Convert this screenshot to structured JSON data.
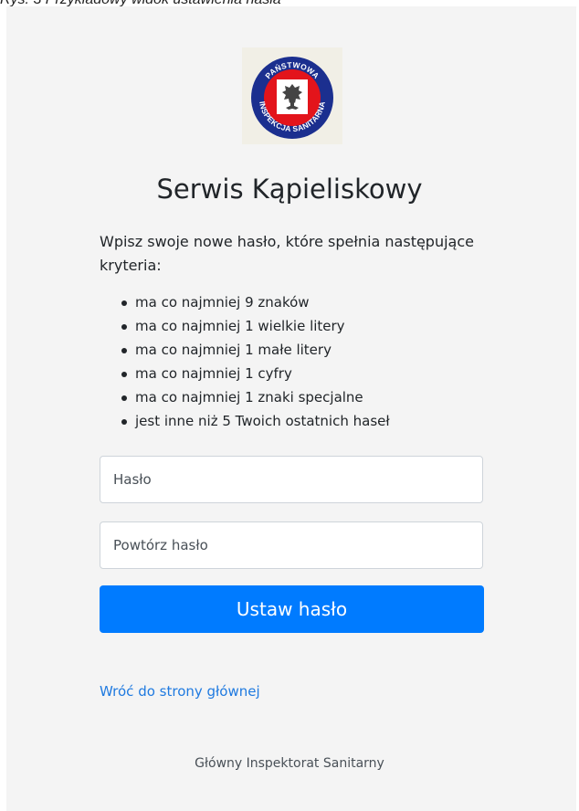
{
  "caption": "Rys. 3 Przykładowy widok ustawienia hasła",
  "logo": {
    "icon": "eagle-emblem",
    "text_top": "PAŃSTWOWA",
    "text_bottom": "INSPEKCJA SANITARNA",
    "colors": {
      "ring": "#1b2f8f",
      "red": "#e3141b",
      "white": "#ffffff"
    }
  },
  "title": "Serwis Kąpieliskowy",
  "intro": "Wpisz swoje nowe hasło, które spełnia następujące kryteria:",
  "criteria": [
    "ma co najmniej 9 znaków",
    "ma co najmniej 1 wielkie litery",
    "ma co najmniej 1 małe litery",
    "ma co najmniej 1 cyfry",
    "ma co najmniej 1 znaki specjalne",
    "jest inne niż 5 Twoich ostatnich haseł"
  ],
  "form": {
    "password_placeholder": "Hasło",
    "password_value": "",
    "repeat_placeholder": "Powtórz hasło",
    "repeat_value": "",
    "submit_label": "Ustaw hasło"
  },
  "back_link": "Wróć do strony głównej",
  "footer": "Główny Inspektorat Sanitarny",
  "colors": {
    "primary": "#007bff",
    "link": "#1f7ae0",
    "panel_bg": "#f4f4f4"
  }
}
